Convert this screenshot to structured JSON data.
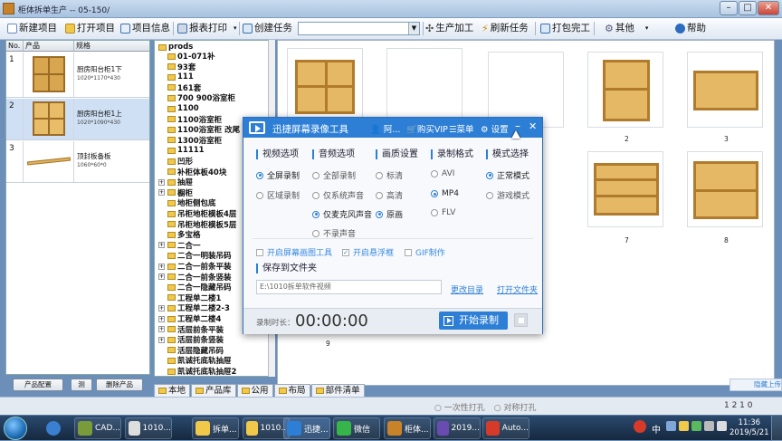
{
  "window": {
    "title": "柜体拆单生产 -- 05-150/"
  },
  "toolbar": {
    "new": "新建项目",
    "open": "打开项目",
    "info": "项目信息",
    "print": "报表打印",
    "create_task": "创建任务",
    "task_value": "",
    "production": "生产加工",
    "refresh": "刷新任务",
    "pack": "打包完工",
    "other": "其他",
    "help": "帮助"
  },
  "grid": {
    "headers": [
      "No.",
      "产品",
      "规格"
    ],
    "rows": [
      {
        "no": "1",
        "name": "厨房阳台柜1下",
        "spec": "1020*1170*430"
      },
      {
        "no": "2",
        "name": "厨房阳台柜1上",
        "spec": "1020*1090*430"
      },
      {
        "no": "3",
        "name": "顶封板备板",
        "spec": "1060*60*0"
      }
    ]
  },
  "grid_buttons": {
    "config": "产品配置",
    "test": "测",
    "delete": "删除产品"
  },
  "tree": {
    "root": "prods",
    "items": [
      "01-071补",
      "93套",
      "111",
      "161套",
      "700 900浴室柜",
      "1100",
      "1100浴室柜",
      "1100浴室柜 改尾",
      "1300浴室柜",
      "11111",
      "凹形",
      "补柜体板40块",
      "抽屉",
      "橱柜",
      "地柜侧包底",
      "吊柜地柜模板4层",
      "吊柜地柜模板5层",
      "多宝格",
      "二合一",
      "二合一明装吊码",
      "二合一前条平装",
      "二合一前条竖装",
      "二合一隐藏吊码",
      "工程单二楼1",
      "工程单二楼2-3",
      "工程单二楼4",
      "活层前条平装",
      "活层前条竖装",
      "活层隐藏吊码",
      "凯诚托底轨抽屉",
      "凯诚托底轨抽屉2"
    ]
  },
  "thumbs": {
    "labels": [
      "2",
      "3",
      "7",
      "8",
      "9"
    ]
  },
  "tabs": [
    "本地",
    "产品库",
    "公用",
    "布局",
    "部件清单"
  ],
  "status": {
    "radio1": "一次性打孔",
    "radio2": "对称打孔",
    "page": "1 2 1 0"
  },
  "recorder": {
    "title": "迅捷屏幕录像工具",
    "user": "阿...",
    "vip": "购买VIP",
    "menu": "菜单",
    "settings": "设置",
    "sections": {
      "video": "视频选项",
      "audio": "音频选项",
      "quality": "画质设置",
      "format": "录制格式",
      "mode": "模式选择"
    },
    "video_opts": [
      "全屏录制",
      "区域录制"
    ],
    "audio_opts": [
      "全部录制",
      "仅系统声音",
      "仅麦克风声音",
      "不录声音"
    ],
    "quality_opts": [
      "标清",
      "高清",
      "原画"
    ],
    "format_opts": [
      "AVI",
      "MP4",
      "FLV"
    ],
    "mode_opts": [
      "正常模式",
      "游戏模式"
    ],
    "checks": [
      "开启屏幕画图工具",
      "开启悬浮框",
      "GIF制作"
    ],
    "save_label": "保存到文件夹",
    "path": "E:\\1010拆单软件视频",
    "change_dir": "更改目录",
    "open_dir": "打开文件夹",
    "time_label": "录制时长：",
    "time": "00:00:00",
    "start": "开始录制"
  },
  "taskbar": {
    "items": [
      "CAD...",
      "1010...",
      "拆单...",
      "1010...",
      "迅捷...",
      "微信",
      "柜体...",
      "2019...",
      "Auto..."
    ],
    "time": "11:36",
    "date": "2019/5/21",
    "sogou": "中"
  },
  "side_hint": "隐藏上传"
}
